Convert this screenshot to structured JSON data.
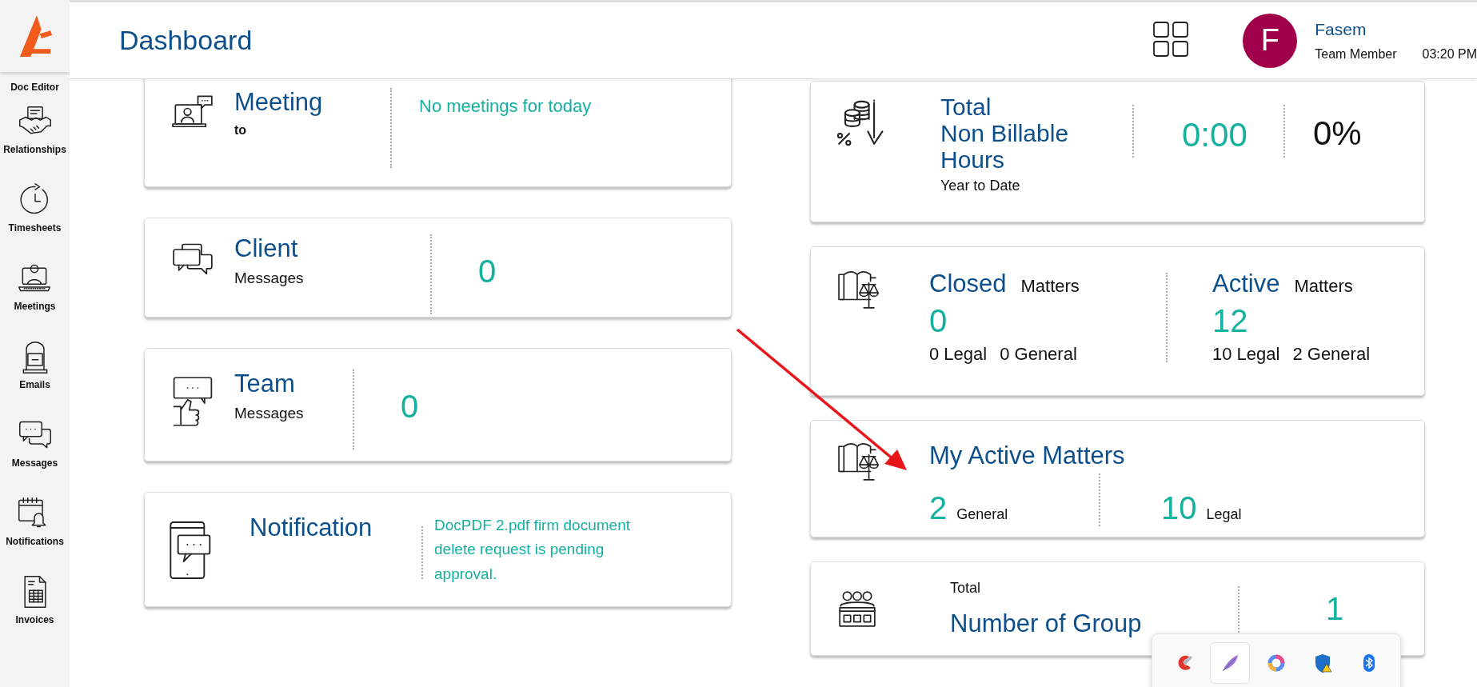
{
  "sidebar": {
    "logo_caption": "Doc Editor",
    "items": [
      {
        "kind": "relationships",
        "label": "Relationships"
      },
      {
        "kind": "timesheets",
        "label": "Timesheets"
      },
      {
        "kind": "meetings",
        "label": "Meetings"
      },
      {
        "kind": "emails",
        "label": "Emails"
      },
      {
        "kind": "messages",
        "label": "Messages"
      },
      {
        "kind": "notifications",
        "label": "Notifications"
      },
      {
        "kind": "invoices",
        "label": "Invoices"
      }
    ]
  },
  "header": {
    "title": "Dashboard",
    "user": {
      "initial": "F",
      "name": "Fasem",
      "role": "Team Member"
    },
    "time": "03:20 PM"
  },
  "left_cards": [
    {
      "kind": "meeting",
      "title": "Meeting",
      "subtitle": "to",
      "value": "No meetings for today"
    },
    {
      "kind": "client_messages",
      "title": "Client",
      "subtitle": "Messages",
      "value": "0"
    },
    {
      "kind": "team_messages",
      "title": "Team",
      "subtitle": "Messages",
      "value": "0"
    },
    {
      "kind": "notification",
      "title": "Notification",
      "value": "DocPDF 2.pdf firm document delete request is pending approval."
    }
  ],
  "hours_card": {
    "title_lines": [
      "Total",
      "Non Billable",
      "Hours"
    ],
    "subtitle": "Year to Date",
    "value": "0:00",
    "percent": "0%"
  },
  "matters_card": {
    "groups": [
      {
        "title": "Closed",
        "label": "Matters",
        "count": "0",
        "breakdown": [
          "0 Legal",
          "0 General"
        ]
      },
      {
        "title": "Active",
        "label": "Matters",
        "count": "12",
        "breakdown": [
          "10 Legal",
          "2 General"
        ]
      }
    ]
  },
  "my_active_card": {
    "title": "My Active Matters",
    "items": [
      {
        "value": "2",
        "label": "General"
      },
      {
        "value": "10",
        "label": "Legal"
      }
    ]
  },
  "groups_card": {
    "label": "Total",
    "title": "Number of Group",
    "value": "1"
  },
  "tray": {
    "items": [
      {
        "kind": "brush",
        "selected": false
      },
      {
        "kind": "feather",
        "selected": true
      },
      {
        "kind": "ring",
        "selected": false
      },
      {
        "kind": "shield",
        "selected": false
      },
      {
        "kind": "bluetooth",
        "selected": false
      }
    ]
  }
}
